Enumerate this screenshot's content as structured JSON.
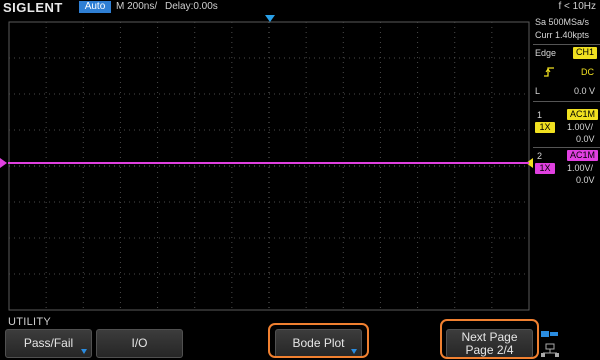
{
  "header": {
    "brand": "SIGLENT",
    "mode": "Auto",
    "timebase": "M 200ns/",
    "delay": "Delay:0.00s",
    "frequency": "f < 10Hz"
  },
  "side_panel": {
    "sample_rate": "Sa 500MSa/s",
    "memory": "Curr 1.40kpts",
    "trigger": {
      "type": "Edge",
      "source": "CH1",
      "slope_icon": "rising-edge-icon",
      "coupling": "DC",
      "level_label": "L",
      "level": "0.0 V"
    },
    "channels": [
      {
        "index": "1",
        "coupling": "AC1M",
        "probe": "1X",
        "scale": "1.00V/",
        "offset": "0.0V",
        "color": "#f0e020"
      },
      {
        "index": "2",
        "coupling": "AC1M",
        "probe": "1X",
        "scale": "1.00V/",
        "offset": "0.0V",
        "color": "#e040e0"
      }
    ]
  },
  "menu": {
    "title": "UTILITY",
    "softkeys": [
      {
        "label": "Pass/Fail",
        "has_submenu": true
      },
      {
        "label": "I/O",
        "has_submenu": false
      },
      {
        "label": "Bode Plot",
        "has_submenu": true
      },
      {
        "label_line1": "Next Page",
        "label_line2": "Page 2/4"
      }
    ]
  },
  "colors": {
    "trace": "#e040e0",
    "grid": "#4a4a4a",
    "trigger_marker": "#2aa0e8",
    "highlight_ring": "#f08030",
    "mode_badge": "#2f7fd4"
  },
  "icons": [
    "trigger-position-marker-icon",
    "channel-level-marker-icon",
    "trigger-level-marker-icon",
    "network-icon"
  ]
}
